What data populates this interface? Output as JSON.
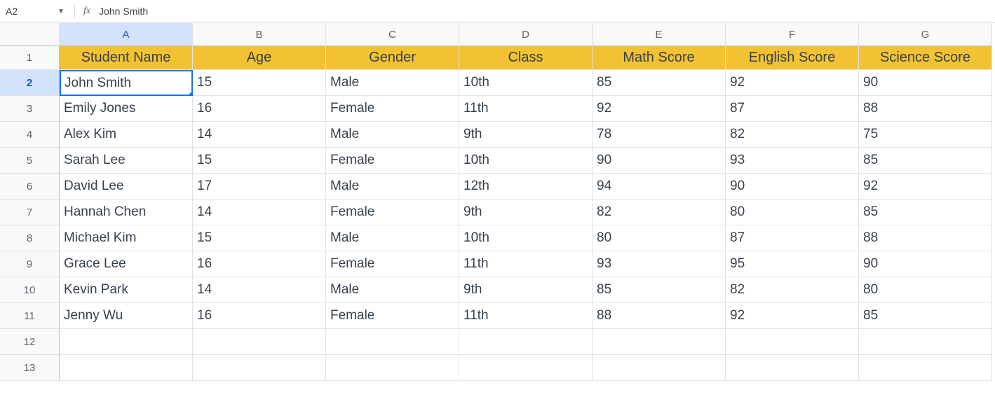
{
  "formula_bar": {
    "name_box": "A2",
    "fx_label": "fx",
    "formula_value": "John Smith"
  },
  "columns": [
    "A",
    "B",
    "C",
    "D",
    "E",
    "F",
    "G"
  ],
  "selected_col_index": 0,
  "selected_row_index": 1,
  "row_numbers": [
    "1",
    "2",
    "3",
    "4",
    "5",
    "6",
    "7",
    "8",
    "9",
    "10",
    "11",
    "12",
    "13"
  ],
  "headers": [
    "Student Name",
    "Age",
    "Gender",
    "Class",
    "Math Score",
    "English Score",
    "Science Score"
  ],
  "rows": [
    [
      "John Smith",
      "15",
      "Male",
      "10th",
      "85",
      "92",
      "90"
    ],
    [
      "Emily Jones",
      "16",
      "Female",
      "11th",
      "92",
      "87",
      "88"
    ],
    [
      "Alex Kim",
      "14",
      "Male",
      "9th",
      "78",
      "82",
      "75"
    ],
    [
      "Sarah Lee",
      "15",
      "Female",
      "10th",
      "90",
      "93",
      "85"
    ],
    [
      "David Lee",
      "17",
      "Male",
      "12th",
      "94",
      "90",
      "92"
    ],
    [
      "Hannah Chen",
      "14",
      "Female",
      "9th",
      "82",
      "80",
      "85"
    ],
    [
      "Michael Kim",
      "15",
      "Male",
      "10th",
      "80",
      "87",
      "88"
    ],
    [
      "Grace Lee",
      "16",
      "Female",
      "11th",
      "93",
      "95",
      "90"
    ],
    [
      "Kevin Park",
      "14",
      "Male",
      "9th",
      "85",
      "82",
      "80"
    ],
    [
      "Jenny Wu",
      "16",
      "Female",
      "11th",
      "88",
      "92",
      "85"
    ]
  ]
}
